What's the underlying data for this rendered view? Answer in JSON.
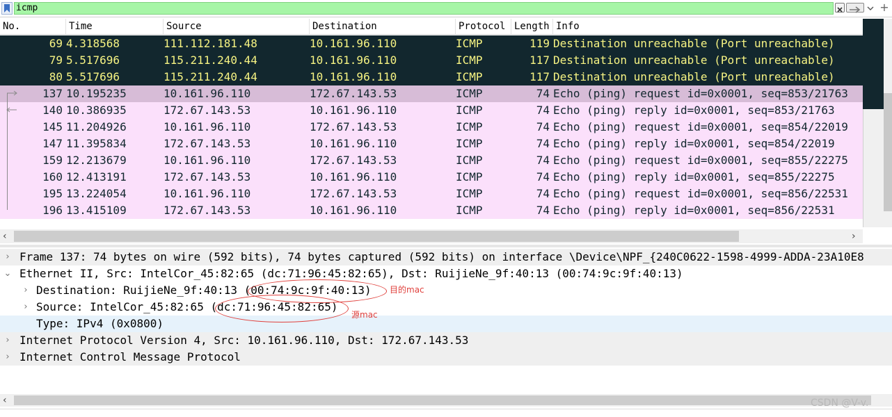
{
  "filter": {
    "value": "icmp"
  },
  "columns": [
    "No.",
    "Time",
    "Source",
    "Destination",
    "Protocol",
    "Length",
    "Info"
  ],
  "packets": [
    {
      "no": "69",
      "time": "4.318568",
      "src": "111.112.181.48",
      "dst": "10.161.96.110",
      "proto": "ICMP",
      "len": "119",
      "info": "Destination unreachable (Port unreachable)",
      "style": "dark"
    },
    {
      "no": "79",
      "time": "5.517696",
      "src": "115.211.240.44",
      "dst": "10.161.96.110",
      "proto": "ICMP",
      "len": "117",
      "info": "Destination unreachable (Port unreachable)",
      "style": "dark"
    },
    {
      "no": "80",
      "time": "5.517696",
      "src": "115.211.240.44",
      "dst": "10.161.96.110",
      "proto": "ICMP",
      "len": "117",
      "info": "Destination unreachable (Port unreachable)",
      "style": "dark"
    },
    {
      "no": "137",
      "time": "10.195235",
      "src": "10.161.96.110",
      "dst": "172.67.143.53",
      "proto": "ICMP",
      "len": "74",
      "info": "Echo (ping) request  id=0x0001, seq=853/21763",
      "style": "selected"
    },
    {
      "no": "140",
      "time": "10.386935",
      "src": "172.67.143.53",
      "dst": "10.161.96.110",
      "proto": "ICMP",
      "len": "74",
      "info": "Echo (ping) reply    id=0x0001, seq=853/21763",
      "style": "pink"
    },
    {
      "no": "145",
      "time": "11.204926",
      "src": "10.161.96.110",
      "dst": "172.67.143.53",
      "proto": "ICMP",
      "len": "74",
      "info": "Echo (ping) request  id=0x0001, seq=854/22019",
      "style": "pink"
    },
    {
      "no": "147",
      "time": "11.395834",
      "src": "172.67.143.53",
      "dst": "10.161.96.110",
      "proto": "ICMP",
      "len": "74",
      "info": "Echo (ping) reply    id=0x0001, seq=854/22019",
      "style": "pink"
    },
    {
      "no": "159",
      "time": "12.213679",
      "src": "10.161.96.110",
      "dst": "172.67.143.53",
      "proto": "ICMP",
      "len": "74",
      "info": "Echo (ping) request  id=0x0001, seq=855/22275",
      "style": "pink"
    },
    {
      "no": "160",
      "time": "12.413191",
      "src": "172.67.143.53",
      "dst": "10.161.96.110",
      "proto": "ICMP",
      "len": "74",
      "info": "Echo (ping) reply    id=0x0001, seq=855/22275",
      "style": "pink"
    },
    {
      "no": "195",
      "time": "13.224054",
      "src": "10.161.96.110",
      "dst": "172.67.143.53",
      "proto": "ICMP",
      "len": "74",
      "info": "Echo (ping) request  id=0x0001, seq=856/22531",
      "style": "pink"
    },
    {
      "no": "196",
      "time": "13.415109",
      "src": "172.67.143.53",
      "dst": "10.161.96.110",
      "proto": "ICMP",
      "len": "74",
      "info": "Echo (ping) reply    id=0x0001, seq=856/22531",
      "style": "pink"
    }
  ],
  "details": {
    "frame": "Frame 137: 74 bytes on wire (592 bits), 74 bytes captured (592 bits) on interface \\Device\\NPF_{240C0622-1598-4999-ADDA-23A10E8",
    "ethernet": "Ethernet II, Src: IntelCor_45:82:65 (dc:71:96:45:82:65), Dst: RuijieNe_9f:40:13 (00:74:9c:9f:40:13)",
    "destination": "Destination: RuijieNe_9f:40:13 (00:74:9c:9f:40:13)",
    "source": "Source: IntelCor_45:82:65 (dc:71:96:45:82:65)",
    "type": "Type: IPv4 (0x0800)",
    "ip": "Internet Protocol Version 4, Src: 10.161.96.110, Dst: 172.67.143.53",
    "icmp": "Internet Control Message Protocol"
  },
  "annotations": {
    "dest_mac_label": "目的mac",
    "src_mac_label": "源mac"
  },
  "watermark": "CSDN @V-v."
}
